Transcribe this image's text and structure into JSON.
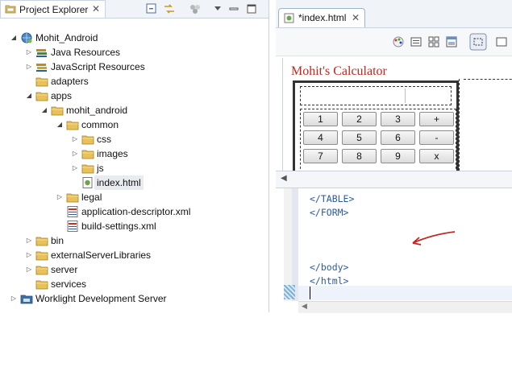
{
  "project_explorer": {
    "tab_title": "Project Explorer",
    "close_glyph": "✕",
    "tree": [
      {
        "label": "Mohit_Android",
        "depth": 0,
        "toggle": "expanded",
        "icon": "android-project-icon"
      },
      {
        "label": "Java Resources",
        "depth": 1,
        "toggle": "collapsed",
        "icon": "java-resources-icon"
      },
      {
        "label": "JavaScript Resources",
        "depth": 1,
        "toggle": "collapsed",
        "icon": "javascript-resources-icon"
      },
      {
        "label": "adapters",
        "depth": 1,
        "toggle": "none",
        "icon": "folder-icon"
      },
      {
        "label": "apps",
        "depth": 1,
        "toggle": "expanded",
        "icon": "folder-icon"
      },
      {
        "label": "mohit_android",
        "depth": 2,
        "toggle": "expanded",
        "icon": "folder-icon"
      },
      {
        "label": "common",
        "depth": 3,
        "toggle": "expanded",
        "icon": "folder-icon"
      },
      {
        "label": "css",
        "depth": 4,
        "toggle": "collapsed",
        "icon": "folder-icon"
      },
      {
        "label": "images",
        "depth": 4,
        "toggle": "collapsed",
        "icon": "folder-icon"
      },
      {
        "label": "js",
        "depth": 4,
        "toggle": "collapsed",
        "icon": "folder-icon"
      },
      {
        "label": "index.html",
        "depth": 4,
        "toggle": "none",
        "icon": "html-file-icon",
        "selected": true
      },
      {
        "label": "legal",
        "depth": 3,
        "toggle": "collapsed",
        "icon": "folder-icon"
      },
      {
        "label": "application-descriptor.xml",
        "depth": 3,
        "toggle": "none",
        "icon": "xml-file-icon"
      },
      {
        "label": "build-settings.xml",
        "depth": 3,
        "toggle": "none",
        "icon": "xml-file-icon"
      },
      {
        "label": "bin",
        "depth": 1,
        "toggle": "collapsed",
        "icon": "folder-icon"
      },
      {
        "label": "externalServerLibraries",
        "depth": 1,
        "toggle": "collapsed",
        "icon": "folder-icon"
      },
      {
        "label": "server",
        "depth": 1,
        "toggle": "collapsed",
        "icon": "folder-icon"
      },
      {
        "label": "services",
        "depth": 1,
        "toggle": "none",
        "icon": "folder-icon"
      },
      {
        "label": "Worklight Development Server",
        "depth": 0,
        "toggle": "collapsed",
        "icon": "server-project-icon"
      }
    ]
  },
  "editor": {
    "tab_title": "*index.html",
    "close_glyph": "✕",
    "design": {
      "page_title": "Mohit's Calculator",
      "keys": [
        [
          "1",
          "2",
          "3",
          "+"
        ],
        [
          "4",
          "5",
          "6",
          "-"
        ],
        [
          "7",
          "8",
          "9",
          "x"
        ]
      ]
    },
    "source_lines": [
      {
        "text": "</TABLE>"
      },
      {
        "text": "</FORM>"
      },
      {
        "text": "</body>"
      },
      {
        "text": "</html>"
      }
    ]
  },
  "colors": {
    "title_red": "#c0271f",
    "code_blue": "#2c5a9e",
    "annotation_arrow": "#c0271f",
    "folder_yellow": "#e8c15a"
  }
}
